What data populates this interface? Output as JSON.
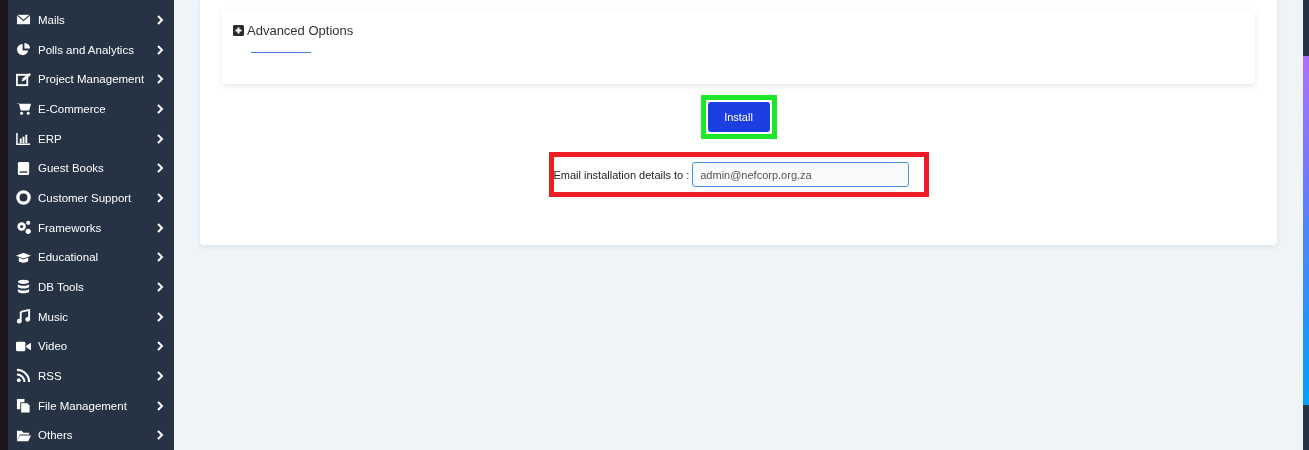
{
  "sidebar": {
    "items": [
      {
        "label": "Mails"
      },
      {
        "label": "Polls and Analytics"
      },
      {
        "label": "Project Management"
      },
      {
        "label": "E-Commerce"
      },
      {
        "label": "ERP"
      },
      {
        "label": "Guest Books"
      },
      {
        "label": "Customer Support"
      },
      {
        "label": "Frameworks"
      },
      {
        "label": "Educational"
      },
      {
        "label": "DB Tools"
      },
      {
        "label": "Music"
      },
      {
        "label": "Video"
      },
      {
        "label": "RSS"
      },
      {
        "label": "File Management"
      },
      {
        "label": "Others"
      }
    ]
  },
  "advanced_options": {
    "label": "Advanced Options",
    "expanded": false
  },
  "install_button": {
    "label": "Install"
  },
  "email": {
    "label": "Email installation details to :",
    "value": "admin@nefcorp.org.za"
  }
}
